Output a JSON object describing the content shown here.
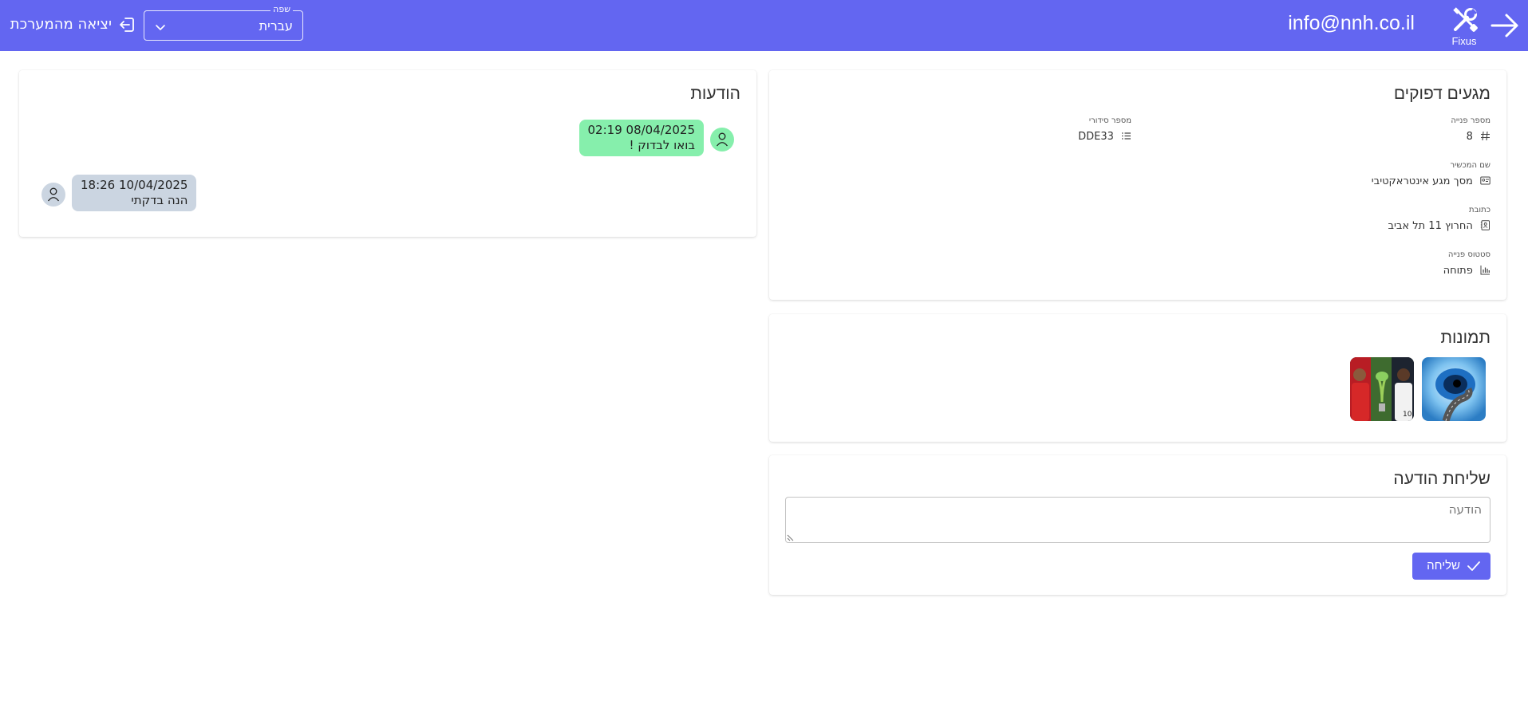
{
  "header": {
    "user_email": "info@nnh.co.il",
    "logo_text": "Fixus",
    "language_label": "שפה",
    "language_value": "עברית",
    "logout_label": "יציאה מהמערכת",
    "bg_color": "#6366f1"
  },
  "details": {
    "title": "מגעים דפוקים",
    "fields": {
      "ticket_number": {
        "label": "מספר פנייה",
        "value": "8",
        "icon": "hash-icon"
      },
      "serial_number": {
        "label": "מספר סידורי",
        "value": "DDE33",
        "icon": "list-icon"
      },
      "device_name": {
        "label": "שם המכשיר",
        "value": "מסך מגע אינטראקטיבי",
        "icon": "id-card-icon"
      },
      "address": {
        "label": "כתובת",
        "value": "החרוץ 11 תל אביב",
        "icon": "address-book-icon"
      },
      "status": {
        "label": "סטטוס פנייה",
        "value": "פתוחה",
        "icon": "bar-chart-icon"
      }
    }
  },
  "images": {
    "title": "תמונות",
    "items": [
      {
        "name": "blue-eye-road-image"
      },
      {
        "name": "football-players-trophy-image"
      }
    ]
  },
  "send": {
    "title": "שליחת הודעה",
    "placeholder": "הודעה",
    "value": "",
    "button_label": "שליחה"
  },
  "messages": {
    "title": "הודעות",
    "items": [
      {
        "date": "08/04/2025 02:19",
        "text": "בואו לבדוק !",
        "side": "right",
        "bubble_color": "#86efac",
        "avatar_color": "#86efac"
      },
      {
        "date": "10/04/2025 18:26",
        "text": "הנה בדקתי",
        "side": "left",
        "bubble_color": "#cbd5e1",
        "avatar_color": "#cbd5e1"
      }
    ]
  }
}
